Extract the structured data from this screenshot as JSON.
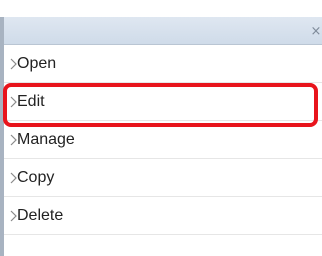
{
  "panel": {
    "close_glyph": "×",
    "close_icon": "close-icon"
  },
  "menu": {
    "items": [
      {
        "label": "Open",
        "icon": "chevron-right-icon"
      },
      {
        "label": "Edit",
        "icon": "chevron-right-icon"
      },
      {
        "label": "Manage",
        "icon": "chevron-right-icon"
      },
      {
        "label": "Copy",
        "icon": "chevron-right-icon"
      },
      {
        "label": "Delete",
        "icon": "chevron-right-icon"
      }
    ]
  },
  "highlight": {
    "target": "Edit",
    "color": "#e8141c"
  }
}
